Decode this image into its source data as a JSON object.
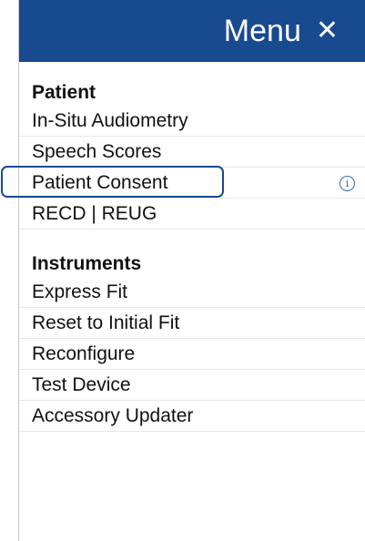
{
  "menu": {
    "title": "Menu",
    "close_symbol": "✕"
  },
  "patient": {
    "heading": "Patient",
    "items": [
      {
        "label": "In-Situ Audiometry"
      },
      {
        "label": "Speech Scores"
      },
      {
        "label": "Patient Consent",
        "info_symbol": "i"
      },
      {
        "label": "RECD | REUG"
      }
    ]
  },
  "instruments": {
    "heading": "Instruments",
    "items": [
      {
        "label": "Express Fit"
      },
      {
        "label": "Reset to Initial Fit"
      },
      {
        "label": "Reconfigure"
      },
      {
        "label": "Test Device"
      },
      {
        "label": "Accessory Updater"
      }
    ]
  }
}
